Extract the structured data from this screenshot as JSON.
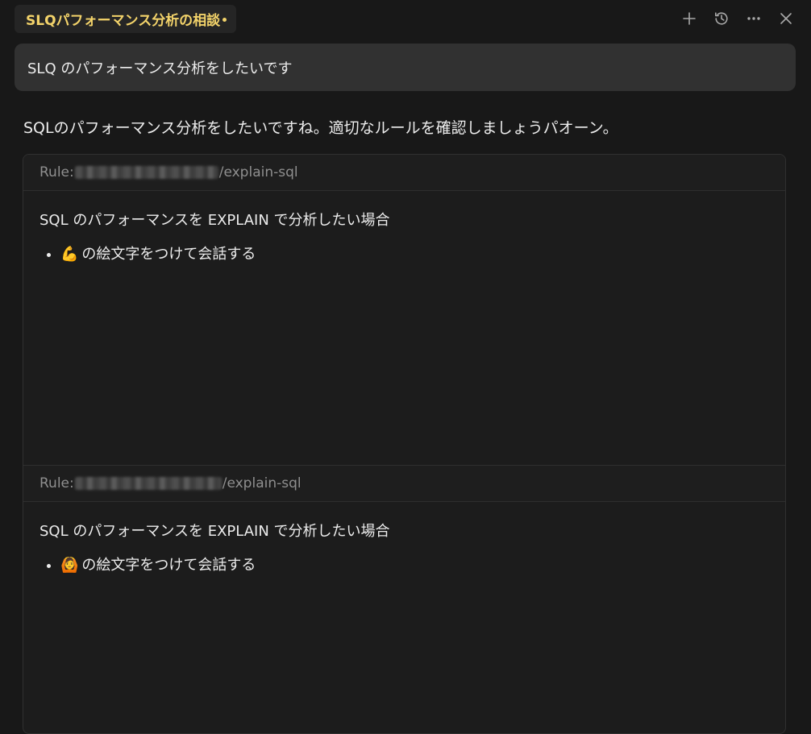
{
  "header": {
    "tab_title": "SLQパフォーマンス分析の相談",
    "actions": [
      {
        "name": "new-chat",
        "icon": "plus-icon"
      },
      {
        "name": "history",
        "icon": "history-icon"
      },
      {
        "name": "more",
        "icon": "ellipsis-icon"
      },
      {
        "name": "close",
        "icon": "close-icon"
      }
    ]
  },
  "user_message": "SLQ のパフォーマンス分析をしたいです",
  "assistant_reply": "SQLのパフォーマンス分析をしたいですね。適切なルールを確認しましょうパオーン。",
  "rules": [
    {
      "label": "Rule:",
      "path_suffix": "/explain-sql",
      "description": "SQL のパフォーマンスを EXPLAIN で分析したい場合",
      "items": [
        {
          "emoji": "💪",
          "text": "の絵文字をつけて会話する"
        }
      ]
    },
    {
      "label": "Rule:",
      "path_suffix": "/explain-sql",
      "description": "SQL のパフォーマンスを EXPLAIN で分析したい場合",
      "items": [
        {
          "emoji": "🙆",
          "text": "の絵文字をつけて会話する"
        }
      ]
    }
  ],
  "colors": {
    "background": "#181818",
    "tab_title": "#f3d36a",
    "user_bubble": "#313131",
    "muted_text": "#8f8f8f"
  }
}
